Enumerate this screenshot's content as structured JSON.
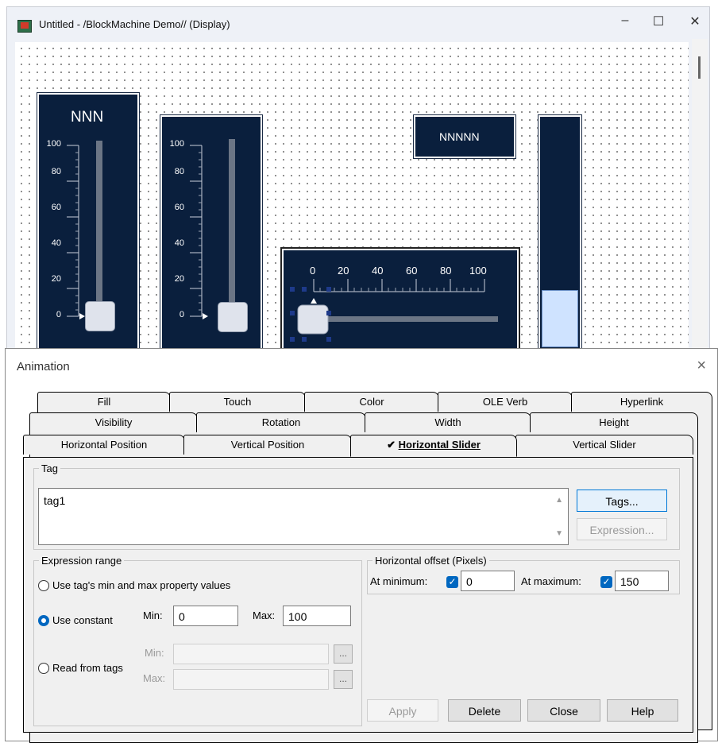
{
  "window": {
    "title": "Untitled - /BlockMachine Demo// (Display)",
    "minimize": "–",
    "maximize": "☐",
    "close": "✕"
  },
  "display": {
    "slider1": {
      "label": "NNN",
      "ticks": [
        "100",
        "80",
        "60",
        "40",
        "20",
        "0"
      ]
    },
    "slider2": {
      "ticks": [
        "100",
        "80",
        "60",
        "40",
        "20",
        "0"
      ]
    },
    "hslider": {
      "ticks": [
        "0",
        "20",
        "40",
        "60",
        "80",
        "100"
      ]
    },
    "numeric_label": "NNNNN",
    "bar_fill_fraction": 0.25
  },
  "dialog": {
    "title": "Animation",
    "close": "×",
    "tabs_row1": [
      "Fill",
      "Touch",
      "Color",
      "OLE Verb",
      "Hyperlink"
    ],
    "tabs_row2": [
      "Visibility",
      "Rotation",
      "Width",
      "Height"
    ],
    "tabs_row3": [
      "Horizontal Position",
      "Vertical Position",
      "Horizontal Slider",
      "Vertical Slider"
    ],
    "selected_tab_mark": "✔",
    "tag": {
      "legend": "Tag",
      "value": "tag1",
      "tags_button": "Tags...",
      "expression_button": "Expression..."
    },
    "expression_range": {
      "legend": "Expression range",
      "option_property": "Use tag's min and max property values",
      "option_constant": "Use constant",
      "min_label": "Min:",
      "min_value": "0",
      "max_label": "Max:",
      "max_value": "100",
      "option_tags": "Read from tags",
      "tags_min_label": "Min:",
      "tags_max_label": "Max:",
      "ellipsis": "..."
    },
    "offset": {
      "legend": "Horizontal offset (Pixels)",
      "at_min_label": "At minimum:",
      "at_min_value": "0",
      "at_max_label": "At maximum:",
      "at_max_value": "150",
      "check": "✓"
    },
    "buttons": {
      "apply": "Apply",
      "delete": "Delete",
      "close": "Close",
      "help": "Help"
    }
  }
}
